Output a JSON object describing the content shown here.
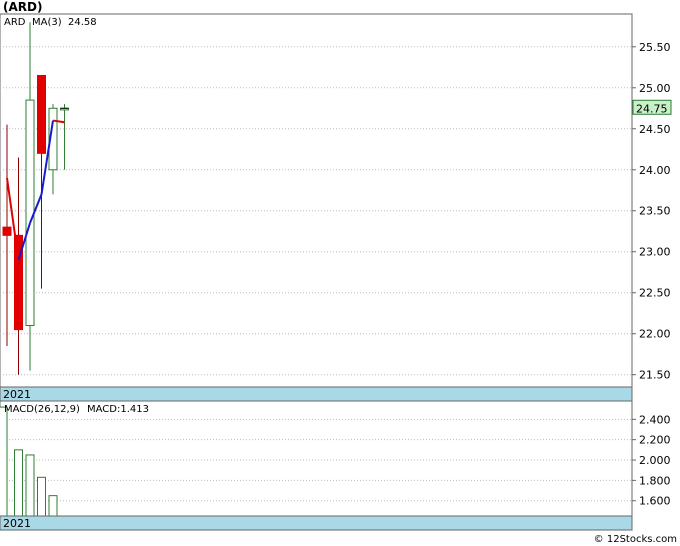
{
  "chart_data": [
    {
      "type": "candlestick",
      "title": "(ARD)",
      "ticker_label": "ARD",
      "ma_label": "MA(3)",
      "ma_value": "24.58",
      "last_price_label": "24.75",
      "date_label": "2021",
      "ylim": [
        21.35,
        25.9
      ],
      "yticks": [
        "25.50",
        "25.00",
        "24.50",
        "24.00",
        "23.50",
        "23.00",
        "22.50",
        "22.00",
        "21.50"
      ],
      "candles": [
        {
          "open": 23.3,
          "high": 24.55,
          "low": 21.85,
          "close": 23.2
        },
        {
          "open": 23.2,
          "high": 24.15,
          "low": 21.5,
          "close": 22.05
        },
        {
          "open": 22.1,
          "high": 25.8,
          "low": 21.55,
          "close": 24.85
        },
        {
          "open": 25.15,
          "high": 25.15,
          "low": 22.55,
          "close": 24.2
        },
        {
          "open": 24.0,
          "high": 24.8,
          "low": 23.7,
          "close": 24.75
        },
        {
          "open": 24.73,
          "high": 24.8,
          "low": 24.0,
          "close": 24.75
        }
      ],
      "ma": [
        23.9,
        22.9,
        23.35,
        23.7,
        24.6,
        24.58
      ],
      "colors": {
        "up": "#2e7d32",
        "down": "#e00000",
        "ma_up": "#1a1acc",
        "ma_down": "#e00000",
        "grid": "#bbbbbb",
        "label_bg": "#c8f0c8",
        "band": "#a9d8e6"
      }
    },
    {
      "type": "bar",
      "title": "MACD(26,12,9)",
      "value_label": "MACD:1.413",
      "date_label": "2021",
      "ylim": [
        1.45,
        2.58
      ],
      "yticks": [
        "2.400",
        "2.200",
        "2.000",
        "1.800",
        "1.600"
      ],
      "values": [
        2.52,
        2.1,
        2.05,
        1.83,
        1.65
      ],
      "colors": {
        "bar": "#2e7d32",
        "grid": "#bbbbbb",
        "band": "#a9d8e6"
      }
    }
  ],
  "footer": {
    "credit": "© 12Stocks.com"
  }
}
